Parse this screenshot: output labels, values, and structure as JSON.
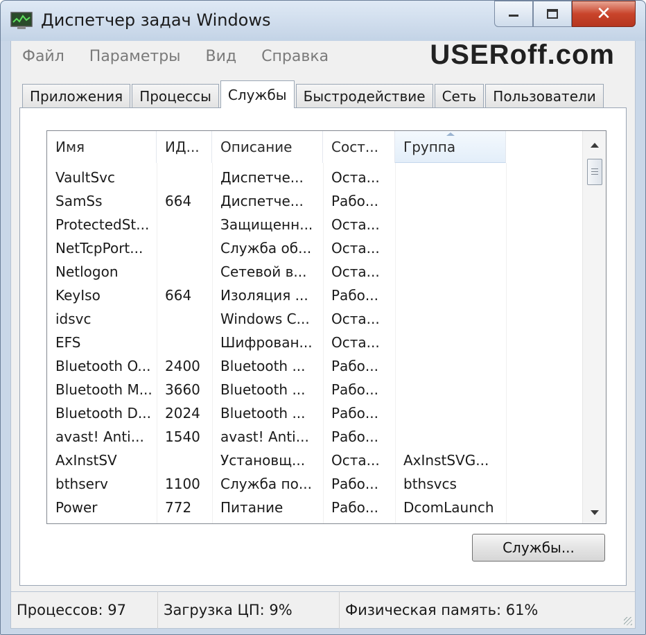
{
  "window": {
    "title": "Диспетчер задач Windows"
  },
  "watermark": {
    "text_a": "USER",
    "text_b": "off.com"
  },
  "menu": [
    "Файл",
    "Параметры",
    "Вид",
    "Справка"
  ],
  "tabs": [
    {
      "label": "Приложения",
      "active": false
    },
    {
      "label": "Процессы",
      "active": false
    },
    {
      "label": "Службы",
      "active": true
    },
    {
      "label": "Быстродействие",
      "active": false
    },
    {
      "label": "Сеть",
      "active": false
    },
    {
      "label": "Пользователи",
      "active": false
    }
  ],
  "table": {
    "columns": [
      "Имя",
      "ИД...",
      "Описание",
      "Сост...",
      "Группа"
    ],
    "sorted_column": "Группа",
    "rows": [
      [
        "VaultSvc",
        "",
        "Диспетче...",
        "Оста...",
        ""
      ],
      [
        "SamSs",
        "664",
        "Диспетче...",
        "Рабо...",
        ""
      ],
      [
        "ProtectedSt...",
        "",
        "Защищенн...",
        "Оста...",
        ""
      ],
      [
        "NetTcpPort...",
        "",
        "Служба об...",
        "Оста...",
        ""
      ],
      [
        "Netlogon",
        "",
        "Сетевой в...",
        "Оста...",
        ""
      ],
      [
        "KeyIso",
        "664",
        "Изоляция ...",
        "Рабо...",
        ""
      ],
      [
        "idsvc",
        "",
        "Windows C...",
        "Оста...",
        ""
      ],
      [
        "EFS",
        "",
        "Шифрован...",
        "Оста...",
        ""
      ],
      [
        "Bluetooth O...",
        "2400",
        "Bluetooth ...",
        "Рабо...",
        ""
      ],
      [
        "Bluetooth M...",
        "3660",
        "Bluetooth ...",
        "Рабо...",
        ""
      ],
      [
        "Bluetooth D...",
        "2024",
        "Bluetooth ...",
        "Рабо...",
        ""
      ],
      [
        "avast! Anti...",
        "1540",
        "avast! Anti...",
        "Рабо...",
        ""
      ],
      [
        "AxInstSV",
        "",
        "Установщ...",
        "Оста...",
        "AxInstSVG..."
      ],
      [
        "bthserv",
        "1100",
        "Служба по...",
        "Рабо...",
        "bthsvcs"
      ],
      [
        "Power",
        "772",
        "Питание",
        "Рабо...",
        "DcomLaunch"
      ]
    ]
  },
  "buttons": {
    "services": "Службы..."
  },
  "status": {
    "processes": "Процессов: 97",
    "cpu": "Загрузка ЦП: 9%",
    "memory": "Физическая память: 61%"
  }
}
